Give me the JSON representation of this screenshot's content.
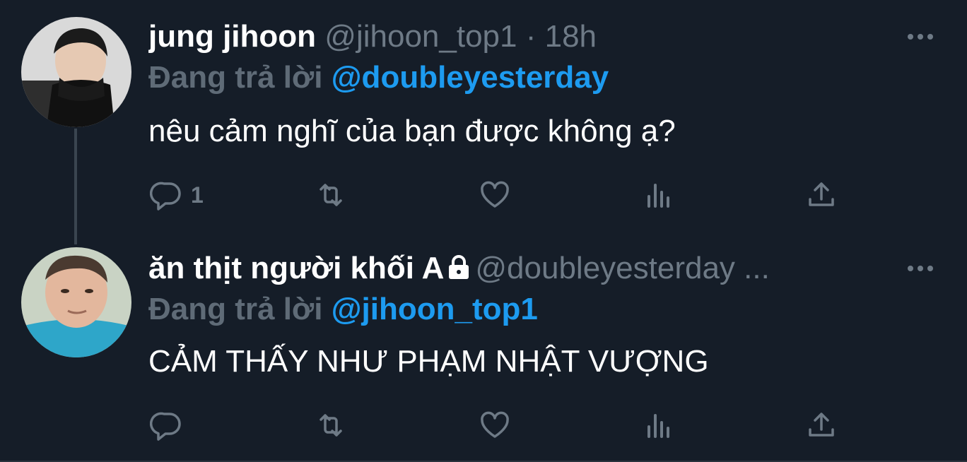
{
  "tweets": [
    {
      "name": "jung jihoon",
      "handle": "@jihoon_top1",
      "separator": " · ",
      "time": "18h",
      "reply_prefix": "Đang trả lời ",
      "reply_to": "@doubleyesterday",
      "text": "nêu cảm nghĩ của bạn được không ạ?",
      "reply_count": "1",
      "locked": false
    },
    {
      "name": "ăn thịt người khối A",
      "handle": "@doubleyesterday ...",
      "reply_prefix": "Đang trả lời ",
      "reply_to": "@jihoon_top1",
      "text": "CẢM THẤY NHƯ PHẠM NHẬT VƯỢNG",
      "reply_count": "",
      "locked": true
    }
  ],
  "icons": {
    "more": "more-horizontal-icon",
    "reply": "reply-bubble-icon",
    "retweet": "retweet-icon",
    "like": "heart-icon",
    "analytics": "analytics-bars-icon",
    "share": "share-upload-icon",
    "lock": "lock-icon"
  },
  "colors": {
    "background": "#151d28",
    "mention": "#1d9bf0",
    "secondary_text": "#6e7a86"
  }
}
